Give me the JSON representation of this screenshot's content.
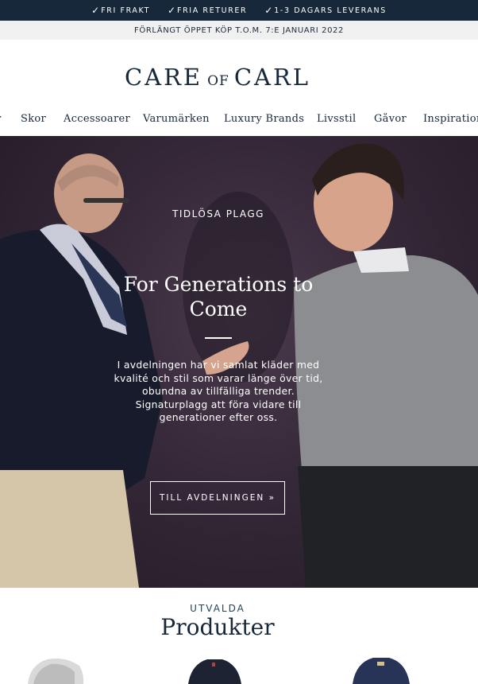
{
  "topbar": {
    "items": [
      {
        "icon": "check-icon",
        "label": "FRI FRAKT"
      },
      {
        "icon": "check-icon",
        "label": "FRIA RETURER"
      },
      {
        "icon": "check-icon",
        "label": "1-3 DAGARS LEVERANS"
      }
    ]
  },
  "notice": {
    "text": "FÖRLÄNGT ÖPPET KÖP T.O.M. 7:E JANUARI 2022"
  },
  "logo": {
    "part1": "CARE",
    "part2": "OF",
    "part3": "CARL"
  },
  "nav": {
    "lead": "r",
    "items": [
      "Skor",
      "Accessoarer",
      "Varumärken",
      "Luxury Brands",
      "Livsstil",
      "Gåvor",
      "Inspiration"
    ]
  },
  "hero": {
    "eyebrow": "TIDLÖSA PLAGG",
    "title": "For Generations to Come",
    "body": "I avdelningen har vi samlat kläder med kvalité och stil som varar länge över tid, obundna av tillfälliga trender. Signaturplagg att föra vidare till generationer efter oss.",
    "cta": "TILL AVDELNINGEN »"
  },
  "featured": {
    "eyebrow": "UTVALDA",
    "title": "Produkter"
  },
  "colors": {
    "topbar": "#16283a",
    "brand_text": "#17283a",
    "hero_bg": "#352838"
  }
}
